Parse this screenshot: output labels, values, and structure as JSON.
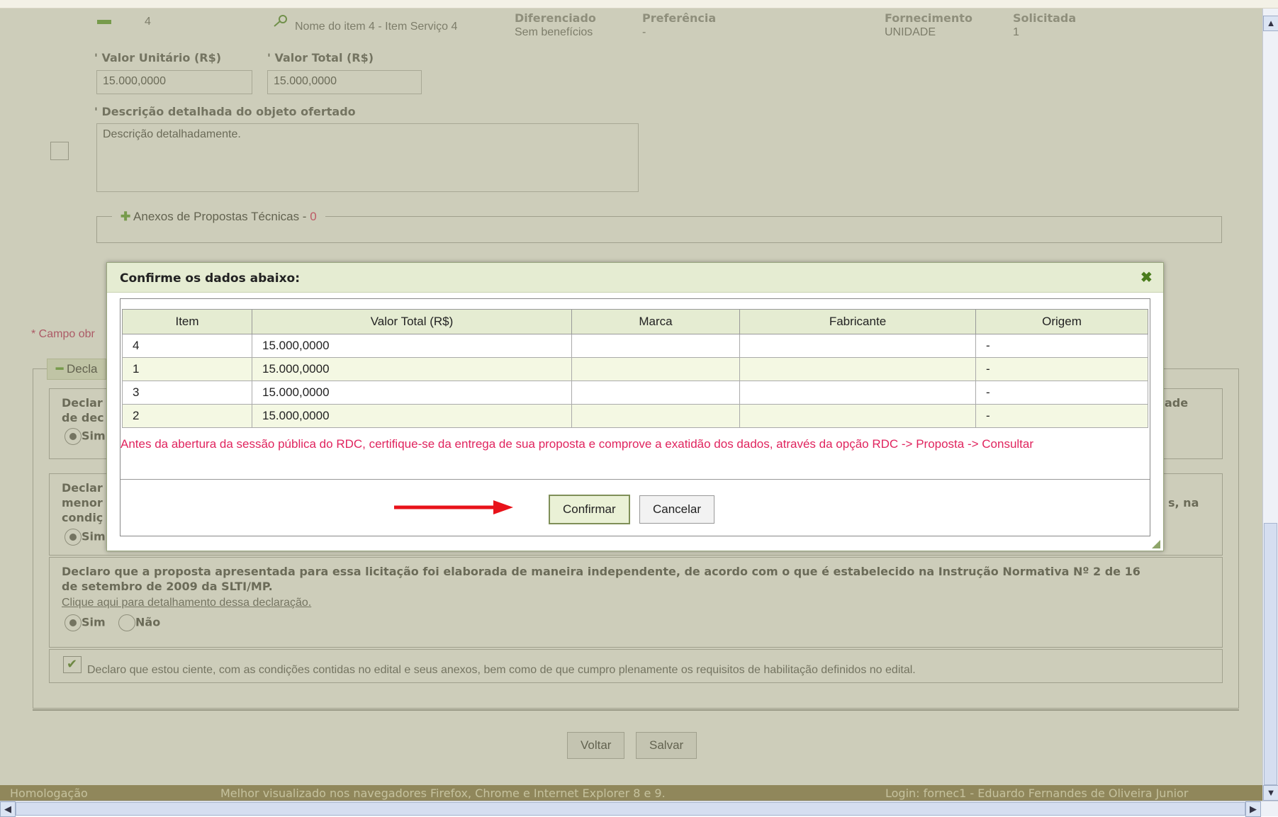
{
  "item": {
    "number": "4",
    "name": "Nome do item 4 - Item Serviço 4",
    "diferenciado_label": "Diferenciado",
    "diferenciado_value": "Sem benefícios",
    "preferencia_label": "Preferência",
    "preferencia_value": "-",
    "fornecimento_label": "Fornecimento",
    "fornecimento_value": "UNIDADE",
    "solicitada_label": "Solicitada",
    "solicitada_value": "1",
    "valor_unitario_label": "Valor Unitário (R$)",
    "valor_unitario_value": "15.000,0000",
    "valor_total_label": "Valor Total (R$)",
    "valor_total_value": "15.000,0000",
    "descricao_label": "Descrição detalhada do objeto ofertado",
    "descricao_value": "Descrição detalhadamente.",
    "anexos_label": "Anexos de Propostas Técnicas - ",
    "anexos_count": "0"
  },
  "campo_obrigatorio": "* Campo obr",
  "declaracoes": {
    "legend": "Decla",
    "decl1_line1": "Declar",
    "decl1_line1_end": "ade",
    "decl1_line2": "de dec",
    "decl1_sim": "Sim",
    "decl2_line1": "Declar",
    "decl2_line2": "menor",
    "decl2_line2_end": "s, na",
    "decl2_line3": "condiç",
    "decl2_sim": "Sim",
    "decl3_text": "Declaro que a proposta apresentada para essa licitação foi elaborada de maneira independente, de acordo com o que é estabelecido na Instrução Normativa Nº 2 de 16",
    "decl3_text2": "de setembro de 2009 da SLTI/MP.",
    "decl3_link": "Clique aqui para detalhamento dessa declaração.",
    "decl3_sim": "Sim",
    "decl3_nao": "Não",
    "ciente_text": "Declaro que estou ciente, com as condições contidas no edital e seus anexos, bem como de que cumpro plenamente os requisitos de habilitação definidos no edital."
  },
  "buttons": {
    "voltar": "Voltar",
    "salvar": "Salvar"
  },
  "footer": {
    "env": "Homologação",
    "browsers": "Melhor visualizado nos navegadores Firefox, Chrome e Internet Explorer 8 e 9.",
    "login": "Login: fornec1 - Eduardo Fernandes de Oliveira Junior"
  },
  "modal": {
    "title": "Confirme os dados abaixo:",
    "close_glyph": "✖",
    "columns": [
      "Item",
      "Valor Total (R$)",
      "Marca",
      "Fabricante",
      "Origem"
    ],
    "rows": [
      [
        "4",
        "15.000,0000",
        "",
        "",
        "-"
      ],
      [
        "1",
        "15.000,0000",
        "",
        "",
        "-"
      ],
      [
        "3",
        "15.000,0000",
        "",
        "",
        "-"
      ],
      [
        "2",
        "15.000,0000",
        "",
        "",
        "-"
      ]
    ],
    "warning": "Antes da abertura da sessão pública do RDC, certifique-se da entrega de sua proposta e comprove a exatidão dos dados, através da opção RDC -> Proposta -> Consultar",
    "confirm_label": "Confirmar",
    "cancel_label": "Cancelar"
  },
  "colors": {
    "arrow": "#e8121a",
    "warning": "#e0245e",
    "footer_bg": "#8a7a4a"
  },
  "icons": [
    "key-icon",
    "plus-icon",
    "minus-icon",
    "close-icon",
    "check-icon",
    "resize-grip-icon",
    "arrow-right-icon"
  ]
}
